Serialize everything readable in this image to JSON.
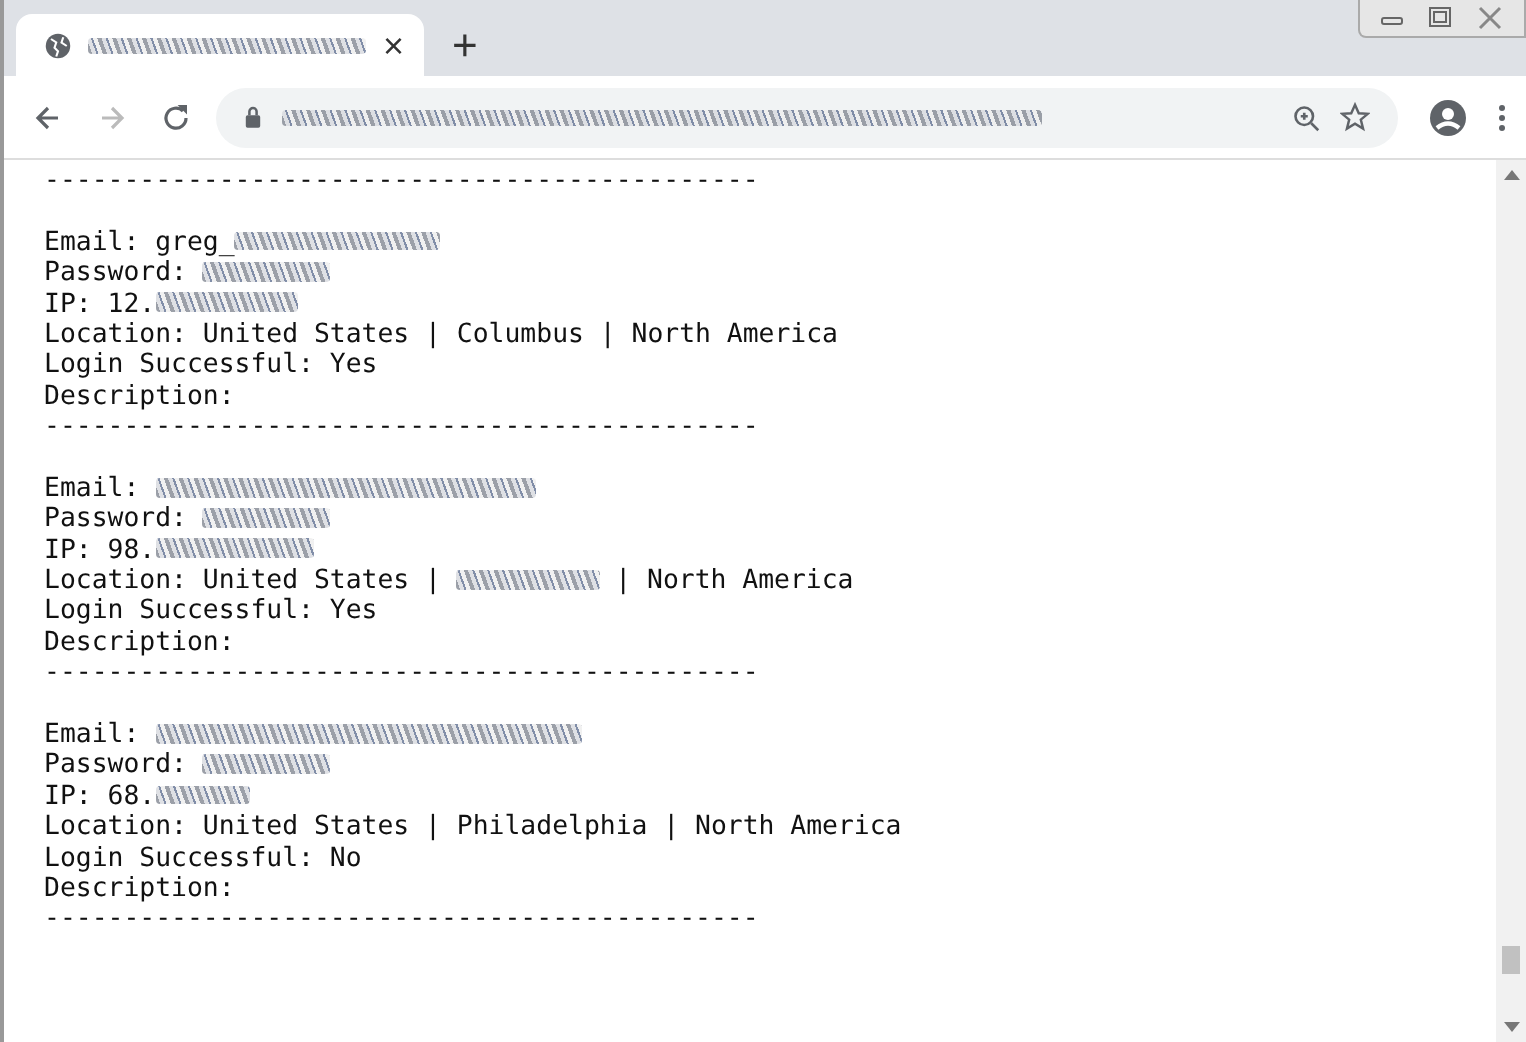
{
  "browser": {
    "new_tab_label": "+",
    "close_tab_label": "×"
  },
  "content": {
    "lines": [
      {
        "kind": "separator",
        "segments": [
          {
            "kind": "text",
            "text": "---------------------------------------------"
          }
        ]
      },
      {
        "kind": "blank"
      },
      {
        "kind": "field",
        "segments": [
          {
            "kind": "text",
            "text": "Email: greg_"
          },
          {
            "kind": "redacted"
          }
        ]
      },
      {
        "kind": "field",
        "segments": [
          {
            "kind": "text",
            "text": "Password: "
          },
          {
            "kind": "redacted"
          }
        ]
      },
      {
        "kind": "field",
        "segments": [
          {
            "kind": "text",
            "text": "IP: 12."
          },
          {
            "kind": "redacted"
          }
        ]
      },
      {
        "kind": "field",
        "segments": [
          {
            "kind": "text",
            "text": "Location: United States | Columbus | North America"
          }
        ]
      },
      {
        "kind": "field",
        "segments": [
          {
            "kind": "text",
            "text": "Login Successful: Yes"
          }
        ]
      },
      {
        "kind": "field",
        "segments": [
          {
            "kind": "text",
            "text": "Description:"
          }
        ]
      },
      {
        "kind": "separator",
        "segments": [
          {
            "kind": "text",
            "text": "---------------------------------------------"
          }
        ]
      },
      {
        "kind": "blank"
      },
      {
        "kind": "field",
        "segments": [
          {
            "kind": "text",
            "text": "Email: "
          },
          {
            "kind": "redacted"
          }
        ]
      },
      {
        "kind": "field",
        "segments": [
          {
            "kind": "text",
            "text": "Password: "
          },
          {
            "kind": "redacted"
          }
        ]
      },
      {
        "kind": "field",
        "segments": [
          {
            "kind": "text",
            "text": "IP: 98."
          },
          {
            "kind": "redacted"
          }
        ]
      },
      {
        "kind": "field",
        "segments": [
          {
            "kind": "text",
            "text": "Location: United States | "
          },
          {
            "kind": "redacted"
          },
          {
            "kind": "text",
            "text": " | North America"
          }
        ]
      },
      {
        "kind": "field",
        "segments": [
          {
            "kind": "text",
            "text": "Login Successful: Yes"
          }
        ]
      },
      {
        "kind": "field",
        "segments": [
          {
            "kind": "text",
            "text": "Description:"
          }
        ]
      },
      {
        "kind": "separator",
        "segments": [
          {
            "kind": "text",
            "text": "---------------------------------------------"
          }
        ]
      },
      {
        "kind": "blank"
      },
      {
        "kind": "field",
        "segments": [
          {
            "kind": "text",
            "text": "Email: "
          },
          {
            "kind": "redacted"
          }
        ]
      },
      {
        "kind": "field",
        "segments": [
          {
            "kind": "text",
            "text": "Password: "
          },
          {
            "kind": "redacted"
          }
        ]
      },
      {
        "kind": "field",
        "segments": [
          {
            "kind": "text",
            "text": "IP: 68."
          },
          {
            "kind": "redacted"
          }
        ]
      },
      {
        "kind": "field",
        "segments": [
          {
            "kind": "text",
            "text": "Location: United States | Philadelphia | North America"
          }
        ]
      },
      {
        "kind": "field",
        "segments": [
          {
            "kind": "text",
            "text": "Login Successful: No"
          }
        ]
      },
      {
        "kind": "field",
        "segments": [
          {
            "kind": "text",
            "text": "Description:"
          }
        ]
      },
      {
        "kind": "separator",
        "segments": [
          {
            "kind": "text",
            "text": "---------------------------------------------"
          }
        ]
      }
    ]
  }
}
